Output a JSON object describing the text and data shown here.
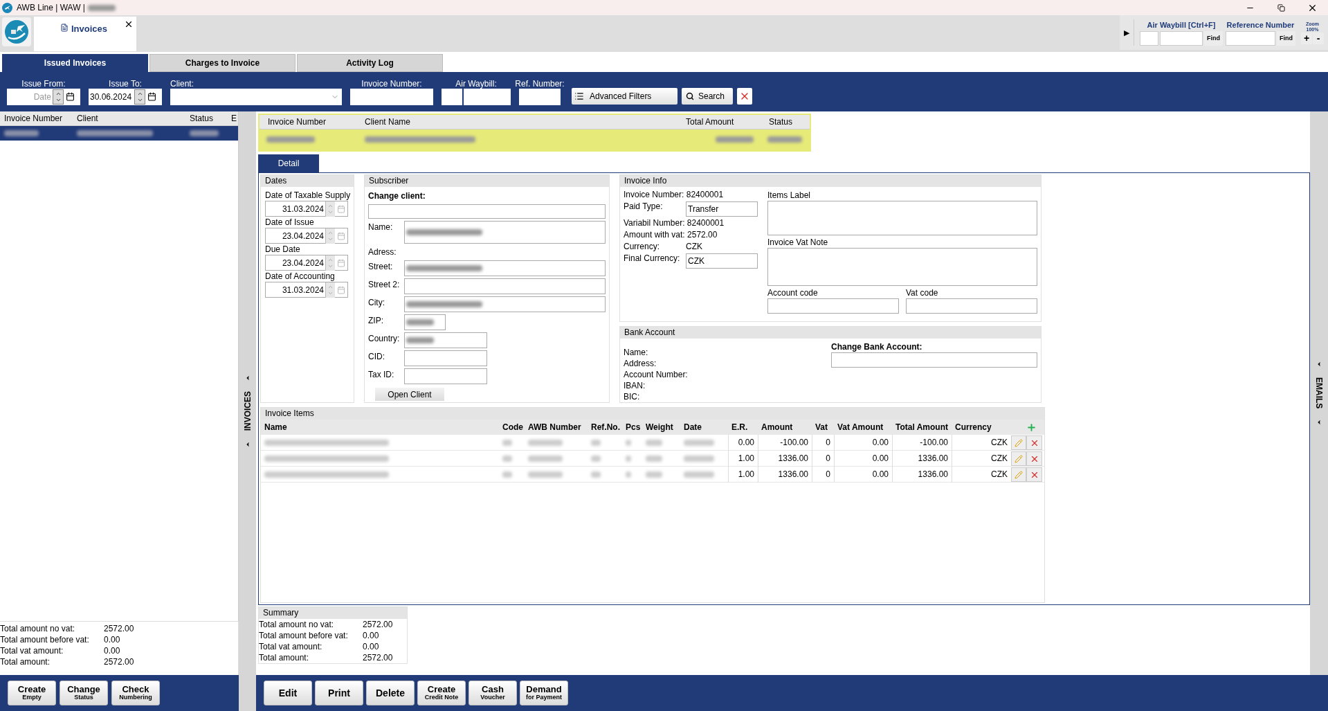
{
  "window": {
    "title": "AWB Line | WAW |",
    "title_redacted": true
  },
  "document_tab": {
    "label": "Invoices"
  },
  "quick_find": {
    "expander": "▶",
    "air_waybill_label": "Air Waybill [Ctrl+F]",
    "reference_label": "Reference Number",
    "find_buttons": [
      "Find",
      "Find"
    ],
    "zoom_label": "Zoom",
    "zoom_value": "100%",
    "zoom_buttons": [
      "+",
      "-"
    ]
  },
  "tabs": [
    {
      "label": "Issued Invoices",
      "selected": true
    },
    {
      "label": "Charges to Invoice",
      "selected": false
    },
    {
      "label": "Activity Log",
      "selected": false
    }
  ],
  "filters": [
    {
      "kind": "date",
      "label": "Issue From:",
      "placeholder": "Date"
    },
    {
      "kind": "date",
      "label": "Issue To:",
      "value": "30.06.2024"
    },
    {
      "kind": "combo",
      "label": "Client:"
    },
    {
      "kind": "text",
      "label": "Invoice Number:"
    },
    {
      "kind": "split",
      "label": "Air Waybill:"
    },
    {
      "kind": "short",
      "label": "Ref. Number:"
    }
  ],
  "filter_buttons": {
    "advanced": "Advanced Filters",
    "search": "Search"
  },
  "invoice_list": {
    "columns": [
      "Invoice Number",
      "Client",
      "Status",
      "E"
    ],
    "rows": [
      {
        "selected": true,
        "redacted": true
      }
    ]
  },
  "list_totals": [
    {
      "label": "Total amount no vat:",
      "value": "2572.00"
    },
    {
      "label": "Total amount before vat:",
      "value": "0.00"
    },
    {
      "label": "Total vat amount:",
      "value": "0.00"
    },
    {
      "label": "Total amount:",
      "value": "2572.00"
    }
  ],
  "list_buttons": [
    {
      "label": "Create",
      "sub": "Empty"
    },
    {
      "label": "Change",
      "sub": "Status"
    },
    {
      "label": "Check",
      "sub": "Numbering"
    }
  ],
  "side_panels": {
    "left": "INVOICES",
    "right": "EMAILS"
  },
  "header_table": {
    "columns": [
      "Invoice Number",
      "Client Name",
      "Total Amount",
      "Status"
    ],
    "rows": [
      {
        "selected": true,
        "redacted": true
      }
    ]
  },
  "detail_tabs": [
    {
      "label": "Detail",
      "selected": true
    }
  ],
  "dates": {
    "title": "Dates",
    "fields": [
      {
        "label": "Date of Taxable Supply",
        "value": "31.03.2024"
      },
      {
        "label": "Date of Issue",
        "value": "23.04.2024"
      },
      {
        "label": "Due Date",
        "value": "23.04.2024"
      },
      {
        "label": "Date of Accounting",
        "value": "31.03.2024"
      }
    ]
  },
  "subscriber": {
    "title": "Subscriber",
    "change_client": "Change client:",
    "fields": [
      {
        "kind": "tall",
        "label": "Name:",
        "redacted": true
      },
      {
        "kind": "heading",
        "label": "Adress:"
      },
      {
        "kind": "wide",
        "label": "Street:",
        "redacted": true
      },
      {
        "kind": "wide",
        "label": "Street 2:",
        "redacted": false
      },
      {
        "kind": "wide",
        "label": "City:",
        "redacted": true
      },
      {
        "kind": "small",
        "label": "ZIP:",
        "redacted": true
      },
      {
        "kind": "medium",
        "label": "Country:",
        "redacted": true
      },
      {
        "kind": "medium",
        "label": "CID:",
        "redacted": false
      },
      {
        "kind": "medium",
        "label": "Tax ID:",
        "redacted": false
      }
    ],
    "open_button": "Open Client"
  },
  "invoice_info": {
    "title": "Invoice Info",
    "lines": [
      {
        "kind": "text",
        "label": "Invoice Number:",
        "value": "82400001"
      },
      {
        "kind": "field",
        "label": "Paid Type:",
        "value": "Transfer"
      },
      {
        "kind": "text",
        "label": "Variabil Number:",
        "value": "82400001"
      },
      {
        "kind": "text",
        "label": "Amount with vat:",
        "value": "2572.00"
      },
      {
        "kind": "column",
        "label": "Currency:",
        "value": "CZK"
      },
      {
        "kind": "field",
        "label": "Final Currency:",
        "value": "CZK"
      }
    ],
    "items_label": "Items Label",
    "vat_note": "Invoice Vat Note",
    "account_code": "Account code",
    "vat_code": "Vat code"
  },
  "bank_account": {
    "title": "Bank Account",
    "labels": [
      "Name:",
      "Address:",
      "Account Number:",
      "IBAN:",
      "BIC:"
    ],
    "change_label": "Change Bank Account:"
  },
  "invoice_items": {
    "title": "Invoice Items",
    "columns": [
      "Name",
      "Code",
      "AWB Number",
      "Ref.No.",
      "Pcs",
      "Weight",
      "Date",
      "E.R.",
      "Amount",
      "Vat",
      "Vat Amount",
      "Total Amount",
      "Currency"
    ],
    "rows": [
      {
        "er": "0.00",
        "amount": "-100.00",
        "vat": "0",
        "vat_amount": "0.00",
        "total": "-100.00",
        "currency": "CZK"
      },
      {
        "er": "1.00",
        "amount": "1336.00",
        "vat": "0",
        "vat_amount": "0.00",
        "total": "1336.00",
        "currency": "CZK"
      },
      {
        "er": "1.00",
        "amount": "1336.00",
        "vat": "0",
        "vat_amount": "0.00",
        "total": "1336.00",
        "currency": "CZK"
      }
    ]
  },
  "summary": {
    "title": "Summary",
    "lines": [
      {
        "label": "Total amount no vat:",
        "value": "2572.00"
      },
      {
        "label": "Total amount before vat:",
        "value": "0.00"
      },
      {
        "label": "Total vat amount:",
        "value": "0.00"
      },
      {
        "label": "Total amount:",
        "value": "2572.00"
      }
    ]
  },
  "detail_buttons": [
    {
      "label": "Edit"
    },
    {
      "label": "Print"
    },
    {
      "label": "Delete"
    },
    {
      "label": "Create",
      "sub": "Credit Note"
    },
    {
      "label": "Cash",
      "sub": "Voucher"
    },
    {
      "label": "Demand",
      "sub": "for Payment"
    }
  ]
}
